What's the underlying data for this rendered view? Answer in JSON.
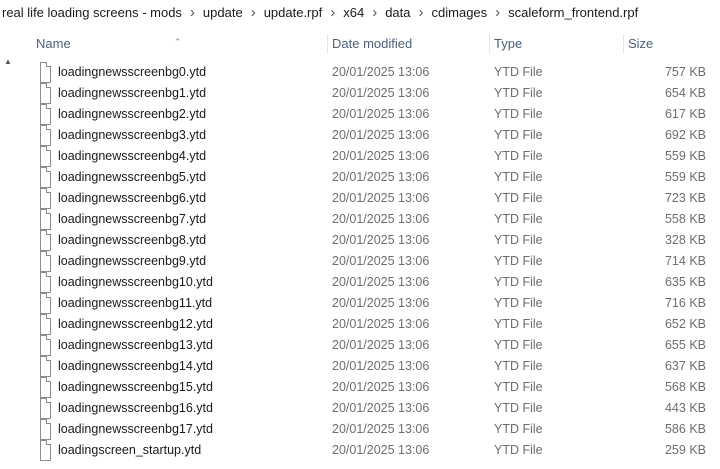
{
  "breadcrumb": [
    "real life loading screens - mods",
    "update",
    "update.rpf",
    "x64",
    "data",
    "cdimages",
    "scaleform_frontend.rpf"
  ],
  "columns": {
    "name": "Name",
    "date": "Date modified",
    "type": "Type",
    "size": "Size"
  },
  "files": [
    {
      "name": "loadingnewsscreenbg0.ytd",
      "date": "20/01/2025 13:06",
      "type": "YTD File",
      "size": "757 KB"
    },
    {
      "name": "loadingnewsscreenbg1.ytd",
      "date": "20/01/2025 13:06",
      "type": "YTD File",
      "size": "654 KB"
    },
    {
      "name": "loadingnewsscreenbg2.ytd",
      "date": "20/01/2025 13:06",
      "type": "YTD File",
      "size": "617 KB"
    },
    {
      "name": "loadingnewsscreenbg3.ytd",
      "date": "20/01/2025 13:06",
      "type": "YTD File",
      "size": "692 KB"
    },
    {
      "name": "loadingnewsscreenbg4.ytd",
      "date": "20/01/2025 13:06",
      "type": "YTD File",
      "size": "559 KB"
    },
    {
      "name": "loadingnewsscreenbg5.ytd",
      "date": "20/01/2025 13:06",
      "type": "YTD File",
      "size": "559 KB"
    },
    {
      "name": "loadingnewsscreenbg6.ytd",
      "date": "20/01/2025 13:06",
      "type": "YTD File",
      "size": "723 KB"
    },
    {
      "name": "loadingnewsscreenbg7.ytd",
      "date": "20/01/2025 13:06",
      "type": "YTD File",
      "size": "558 KB"
    },
    {
      "name": "loadingnewsscreenbg8.ytd",
      "date": "20/01/2025 13:06",
      "type": "YTD File",
      "size": "328 KB"
    },
    {
      "name": "loadingnewsscreenbg9.ytd",
      "date": "20/01/2025 13:06",
      "type": "YTD File",
      "size": "714 KB"
    },
    {
      "name": "loadingnewsscreenbg10.ytd",
      "date": "20/01/2025 13:06",
      "type": "YTD File",
      "size": "635 KB"
    },
    {
      "name": "loadingnewsscreenbg11.ytd",
      "date": "20/01/2025 13:06",
      "type": "YTD File",
      "size": "716 KB"
    },
    {
      "name": "loadingnewsscreenbg12.ytd",
      "date": "20/01/2025 13:06",
      "type": "YTD File",
      "size": "652 KB"
    },
    {
      "name": "loadingnewsscreenbg13.ytd",
      "date": "20/01/2025 13:06",
      "type": "YTD File",
      "size": "655 KB"
    },
    {
      "name": "loadingnewsscreenbg14.ytd",
      "date": "20/01/2025 13:06",
      "type": "YTD File",
      "size": "637 KB"
    },
    {
      "name": "loadingnewsscreenbg15.ytd",
      "date": "20/01/2025 13:06",
      "type": "YTD File",
      "size": "568 KB"
    },
    {
      "name": "loadingnewsscreenbg16.ytd",
      "date": "20/01/2025 13:06",
      "type": "YTD File",
      "size": "443 KB"
    },
    {
      "name": "loadingnewsscreenbg17.ytd",
      "date": "20/01/2025 13:06",
      "type": "YTD File",
      "size": "586 KB"
    },
    {
      "name": "loadingscreen_startup.ytd",
      "date": "20/01/2025 13:06",
      "type": "YTD File",
      "size": "259 KB"
    }
  ]
}
